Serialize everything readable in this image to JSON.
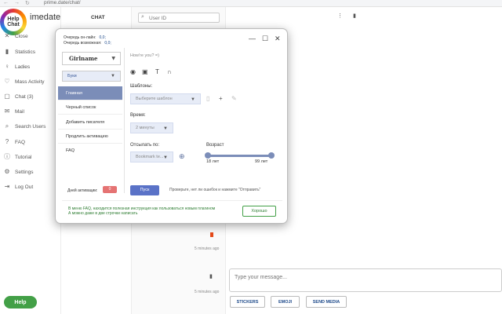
{
  "browser": {
    "back": "←",
    "forward": "→",
    "reload": "↻",
    "url": "prime.date/chat/"
  },
  "sidebar": {
    "logo_text": "Help Chat",
    "brand": "imedate",
    "items": [
      {
        "label": "Close",
        "icon": "close-icon",
        "glyph": "✕"
      },
      {
        "label": "Statistics",
        "icon": "bar-chart-icon",
        "glyph": "▮"
      },
      {
        "label": "Ladies",
        "icon": "user-icon",
        "glyph": "♀"
      },
      {
        "label": "Mass Activity",
        "icon": "heart-icon",
        "glyph": "♡"
      },
      {
        "label": "Chat (3)",
        "icon": "chat-icon",
        "glyph": "▢"
      },
      {
        "label": "Mail",
        "icon": "mail-icon",
        "glyph": "✉"
      },
      {
        "label": "Search Users",
        "icon": "search-icon",
        "glyph": "⌕"
      },
      {
        "label": "FAQ",
        "icon": "question-icon",
        "glyph": "?"
      },
      {
        "label": "Tutorial",
        "icon": "info-icon",
        "glyph": "ⓘ"
      },
      {
        "label": "Settings",
        "icon": "gear-icon",
        "glyph": "⚙"
      },
      {
        "label": "Log Out",
        "icon": "logout-icon",
        "glyph": "⇥"
      }
    ],
    "help_label": "Help"
  },
  "chat": {
    "title": "CHAT",
    "search_placeholder": "User ID",
    "time_1": "5 minutes ago",
    "time_2": "5 minutes ago"
  },
  "compose": {
    "placeholder": "Type your message...",
    "stickers": "STICKERS",
    "emoji": "EMOJI",
    "send_media": "SEND MEDIA"
  },
  "modal": {
    "stat_online_label": "Очередь он-лайн:",
    "stat_online_value": "0,0;",
    "stat_offline_label": "Очередь возможная:",
    "stat_offline_value": "0,0;",
    "girlname": "Girlname",
    "letters": "Буки",
    "menu": [
      "Главная",
      "Черный список",
      "Добавить писателя",
      "Продлить активацию",
      "FAQ"
    ],
    "activation_label": "Дней активации:",
    "activation_value": "0",
    "preview": "How're you? =)",
    "templates_label": "Шаблоны:",
    "templates_placeholder": "Выберите шаблон",
    "time_label": "Время:",
    "time_value": "2 минуты",
    "send_label": "Отсылать по:",
    "send_value": "Bookmark te...",
    "age_label": "Возраст",
    "age_min": "18 лет",
    "age_max": "99 лет",
    "search_btn": "Пуск",
    "check_text": "Проверьте, нет ли ошибок и нажмите \"Отправить\"",
    "note_line1": "В меню FAQ, находится полезная инструкция как пользоваться новым плагином",
    "note_line2": "А можно даже в две строчки написать",
    "ok_btn": "Хорошо"
  }
}
